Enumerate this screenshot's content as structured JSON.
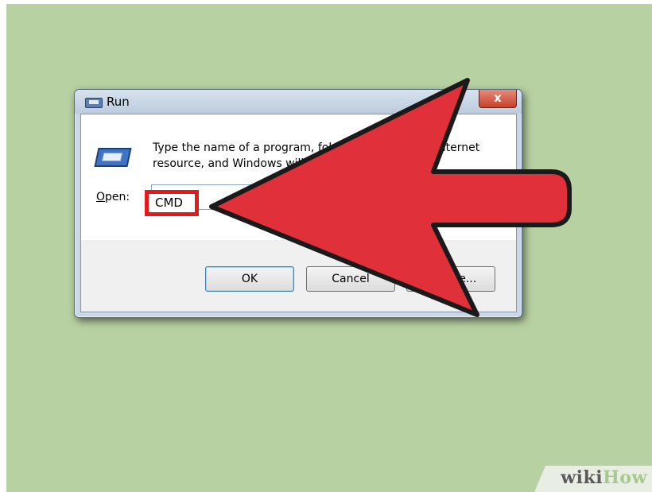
{
  "dialog": {
    "title": "Run",
    "close_label": "x",
    "description_line1": "Type the name of a program, folder, document, or Internet",
    "description_line2": "resource, and Windows will open it for you.",
    "open_label_accel": "O",
    "open_label_rest": "pen:",
    "open_value": "CMD",
    "buttons": {
      "ok": "OK",
      "cancel": "Cancel",
      "browse": "Browse..."
    }
  },
  "colors": {
    "background": "#b8d1a3",
    "arrow_fill": "#e0313a",
    "highlight_box": "#e21a1a"
  },
  "annotation": {
    "arrow_direction": "left",
    "points_to": "open-value"
  },
  "watermark": {
    "part1": "wiki",
    "part2": "How"
  }
}
